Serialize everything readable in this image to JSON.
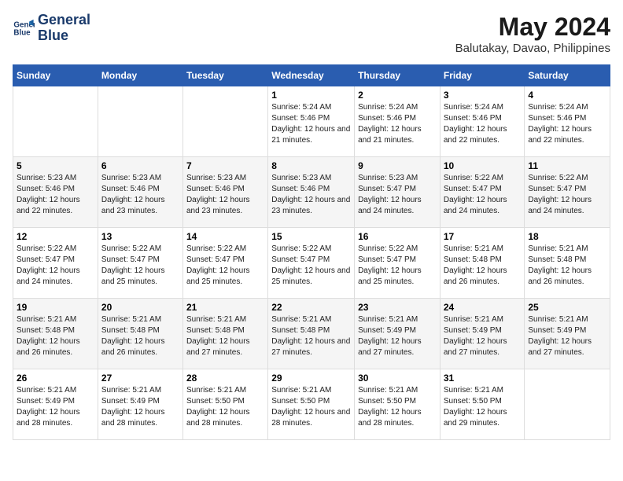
{
  "logo": {
    "line1": "General",
    "line2": "Blue"
  },
  "title": "May 2024",
  "subtitle": "Balutakay, Davao, Philippines",
  "weekdays": [
    "Sunday",
    "Monday",
    "Tuesday",
    "Wednesday",
    "Thursday",
    "Friday",
    "Saturday"
  ],
  "weeks": [
    [
      {
        "day": "",
        "sunrise": "",
        "sunset": "",
        "daylight": ""
      },
      {
        "day": "",
        "sunrise": "",
        "sunset": "",
        "daylight": ""
      },
      {
        "day": "",
        "sunrise": "",
        "sunset": "",
        "daylight": ""
      },
      {
        "day": "1",
        "sunrise": "Sunrise: 5:24 AM",
        "sunset": "Sunset: 5:46 PM",
        "daylight": "Daylight: 12 hours and 21 minutes."
      },
      {
        "day": "2",
        "sunrise": "Sunrise: 5:24 AM",
        "sunset": "Sunset: 5:46 PM",
        "daylight": "Daylight: 12 hours and 21 minutes."
      },
      {
        "day": "3",
        "sunrise": "Sunrise: 5:24 AM",
        "sunset": "Sunset: 5:46 PM",
        "daylight": "Daylight: 12 hours and 22 minutes."
      },
      {
        "day": "4",
        "sunrise": "Sunrise: 5:24 AM",
        "sunset": "Sunset: 5:46 PM",
        "daylight": "Daylight: 12 hours and 22 minutes."
      }
    ],
    [
      {
        "day": "5",
        "sunrise": "Sunrise: 5:23 AM",
        "sunset": "Sunset: 5:46 PM",
        "daylight": "Daylight: 12 hours and 22 minutes."
      },
      {
        "day": "6",
        "sunrise": "Sunrise: 5:23 AM",
        "sunset": "Sunset: 5:46 PM",
        "daylight": "Daylight: 12 hours and 23 minutes."
      },
      {
        "day": "7",
        "sunrise": "Sunrise: 5:23 AM",
        "sunset": "Sunset: 5:46 PM",
        "daylight": "Daylight: 12 hours and 23 minutes."
      },
      {
        "day": "8",
        "sunrise": "Sunrise: 5:23 AM",
        "sunset": "Sunset: 5:46 PM",
        "daylight": "Daylight: 12 hours and 23 minutes."
      },
      {
        "day": "9",
        "sunrise": "Sunrise: 5:23 AM",
        "sunset": "Sunset: 5:47 PM",
        "daylight": "Daylight: 12 hours and 24 minutes."
      },
      {
        "day": "10",
        "sunrise": "Sunrise: 5:22 AM",
        "sunset": "Sunset: 5:47 PM",
        "daylight": "Daylight: 12 hours and 24 minutes."
      },
      {
        "day": "11",
        "sunrise": "Sunrise: 5:22 AM",
        "sunset": "Sunset: 5:47 PM",
        "daylight": "Daylight: 12 hours and 24 minutes."
      }
    ],
    [
      {
        "day": "12",
        "sunrise": "Sunrise: 5:22 AM",
        "sunset": "Sunset: 5:47 PM",
        "daylight": "Daylight: 12 hours and 24 minutes."
      },
      {
        "day": "13",
        "sunrise": "Sunrise: 5:22 AM",
        "sunset": "Sunset: 5:47 PM",
        "daylight": "Daylight: 12 hours and 25 minutes."
      },
      {
        "day": "14",
        "sunrise": "Sunrise: 5:22 AM",
        "sunset": "Sunset: 5:47 PM",
        "daylight": "Daylight: 12 hours and 25 minutes."
      },
      {
        "day": "15",
        "sunrise": "Sunrise: 5:22 AM",
        "sunset": "Sunset: 5:47 PM",
        "daylight": "Daylight: 12 hours and 25 minutes."
      },
      {
        "day": "16",
        "sunrise": "Sunrise: 5:22 AM",
        "sunset": "Sunset: 5:47 PM",
        "daylight": "Daylight: 12 hours and 25 minutes."
      },
      {
        "day": "17",
        "sunrise": "Sunrise: 5:21 AM",
        "sunset": "Sunset: 5:48 PM",
        "daylight": "Daylight: 12 hours and 26 minutes."
      },
      {
        "day": "18",
        "sunrise": "Sunrise: 5:21 AM",
        "sunset": "Sunset: 5:48 PM",
        "daylight": "Daylight: 12 hours and 26 minutes."
      }
    ],
    [
      {
        "day": "19",
        "sunrise": "Sunrise: 5:21 AM",
        "sunset": "Sunset: 5:48 PM",
        "daylight": "Daylight: 12 hours and 26 minutes."
      },
      {
        "day": "20",
        "sunrise": "Sunrise: 5:21 AM",
        "sunset": "Sunset: 5:48 PM",
        "daylight": "Daylight: 12 hours and 26 minutes."
      },
      {
        "day": "21",
        "sunrise": "Sunrise: 5:21 AM",
        "sunset": "Sunset: 5:48 PM",
        "daylight": "Daylight: 12 hours and 27 minutes."
      },
      {
        "day": "22",
        "sunrise": "Sunrise: 5:21 AM",
        "sunset": "Sunset: 5:48 PM",
        "daylight": "Daylight: 12 hours and 27 minutes."
      },
      {
        "day": "23",
        "sunrise": "Sunrise: 5:21 AM",
        "sunset": "Sunset: 5:49 PM",
        "daylight": "Daylight: 12 hours and 27 minutes."
      },
      {
        "day": "24",
        "sunrise": "Sunrise: 5:21 AM",
        "sunset": "Sunset: 5:49 PM",
        "daylight": "Daylight: 12 hours and 27 minutes."
      },
      {
        "day": "25",
        "sunrise": "Sunrise: 5:21 AM",
        "sunset": "Sunset: 5:49 PM",
        "daylight": "Daylight: 12 hours and 27 minutes."
      }
    ],
    [
      {
        "day": "26",
        "sunrise": "Sunrise: 5:21 AM",
        "sunset": "Sunset: 5:49 PM",
        "daylight": "Daylight: 12 hours and 28 minutes."
      },
      {
        "day": "27",
        "sunrise": "Sunrise: 5:21 AM",
        "sunset": "Sunset: 5:49 PM",
        "daylight": "Daylight: 12 hours and 28 minutes."
      },
      {
        "day": "28",
        "sunrise": "Sunrise: 5:21 AM",
        "sunset": "Sunset: 5:50 PM",
        "daylight": "Daylight: 12 hours and 28 minutes."
      },
      {
        "day": "29",
        "sunrise": "Sunrise: 5:21 AM",
        "sunset": "Sunset: 5:50 PM",
        "daylight": "Daylight: 12 hours and 28 minutes."
      },
      {
        "day": "30",
        "sunrise": "Sunrise: 5:21 AM",
        "sunset": "Sunset: 5:50 PM",
        "daylight": "Daylight: 12 hours and 28 minutes."
      },
      {
        "day": "31",
        "sunrise": "Sunrise: 5:21 AM",
        "sunset": "Sunset: 5:50 PM",
        "daylight": "Daylight: 12 hours and 29 minutes."
      },
      {
        "day": "",
        "sunrise": "",
        "sunset": "",
        "daylight": ""
      }
    ]
  ]
}
